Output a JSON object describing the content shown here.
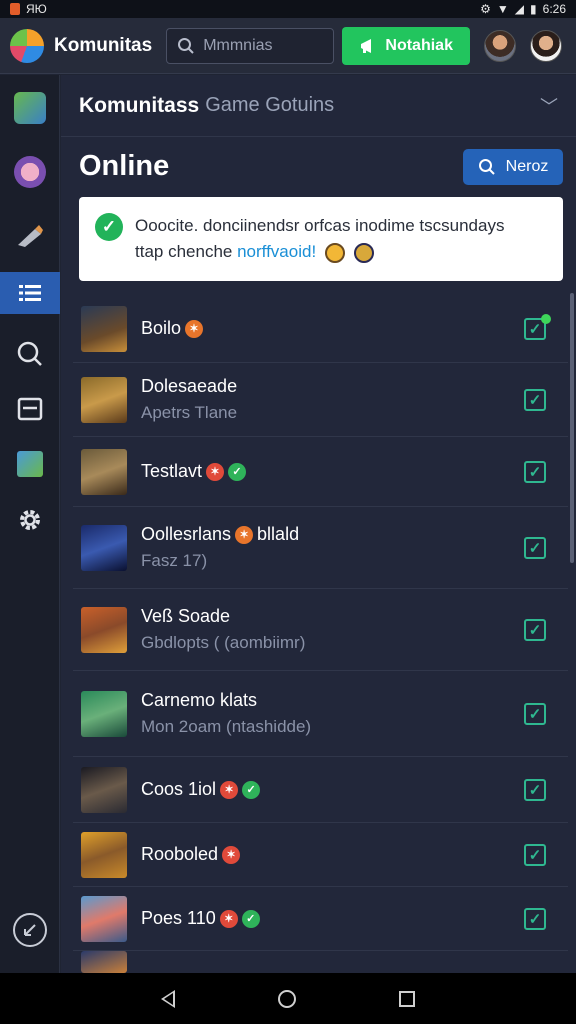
{
  "statusbar": {
    "left_text": "ЯЮ",
    "time": "6:26"
  },
  "topbar": {
    "app_title": "Komunitas",
    "search_placeholder": "Mmmnias",
    "notify_label": "Notahiak"
  },
  "section": {
    "title_bold": "Komunitass",
    "title_light": "Game Gotuins"
  },
  "online": {
    "title": "Online",
    "news_label": "Neroz"
  },
  "notice": {
    "line1": "Ooocite. donciinendsr orfcas inodime tscsundays",
    "line2_prefix": "ttap chenche",
    "line2_link": "norffvaoid!"
  },
  "rows": [
    {
      "name": "Boilo",
      "sub": "",
      "badges": [
        "orange"
      ],
      "checked": true,
      "online_dot": true
    },
    {
      "name": "Dolesaeade",
      "sub": "Apetrs Tlane",
      "badges": [],
      "checked": true,
      "online_dot": false
    },
    {
      "name": "Testlavt",
      "sub": "",
      "badges": [
        "red",
        "green"
      ],
      "checked": true,
      "online_dot": false
    },
    {
      "name": "Oollesrlans",
      "name_suffix": "bllald",
      "sub": "Fasz 17)",
      "badges": [
        "orange"
      ],
      "checked": true,
      "online_dot": false
    },
    {
      "name": "Veß Soade",
      "sub": "Gbdlopts ( (aombiimr)",
      "badges": [],
      "checked": true,
      "online_dot": false
    },
    {
      "name": "Carnemo klats",
      "sub": "Mon 2oam (ntashidde)",
      "badges": [],
      "checked": true,
      "online_dot": false
    },
    {
      "name": "Coos 1iol",
      "sub": "",
      "badges": [
        "red",
        "green"
      ],
      "checked": true,
      "online_dot": false
    },
    {
      "name": "Rooboled",
      "sub": "",
      "badges": [
        "red"
      ],
      "checked": true,
      "online_dot": false
    },
    {
      "name": "Poes 110",
      "sub": "",
      "badges": [
        "red",
        "green"
      ],
      "checked": true,
      "online_dot": false
    }
  ],
  "colors": {
    "accent_green": "#22c55e",
    "accent_blue": "#2563b8",
    "checkbox": "#2fb890"
  }
}
